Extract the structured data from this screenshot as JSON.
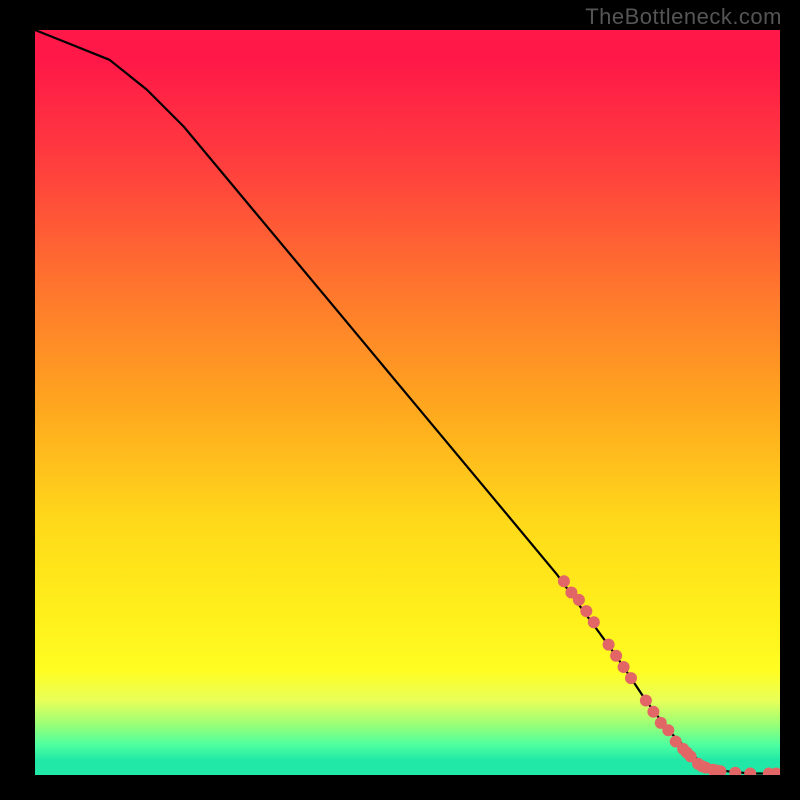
{
  "watermark": "TheBottleneck.com",
  "chart_data": {
    "type": "line",
    "title": "",
    "xlabel": "",
    "ylabel": "",
    "xlim": [
      0,
      100
    ],
    "ylim": [
      0,
      100
    ],
    "legend": false,
    "grid": false,
    "series": [
      {
        "name": "curve",
        "x": [
          0,
          5,
          10,
          15,
          20,
          30,
          40,
          50,
          60,
          70,
          78,
          82,
          85,
          88,
          90,
          93,
          96,
          100
        ],
        "y": [
          100,
          98,
          96,
          92,
          87,
          75,
          63,
          51,
          39,
          27,
          16,
          10,
          6,
          3,
          1,
          0.5,
          0.2,
          0.2
        ]
      }
    ],
    "markers": {
      "name": "highlighted-points",
      "color": "#e36666",
      "points": [
        {
          "x": 71,
          "y": 26
        },
        {
          "x": 72,
          "y": 24.5
        },
        {
          "x": 73,
          "y": 23.5
        },
        {
          "x": 74,
          "y": 22
        },
        {
          "x": 75,
          "y": 20.5
        },
        {
          "x": 77,
          "y": 17.5
        },
        {
          "x": 78,
          "y": 16
        },
        {
          "x": 79,
          "y": 14.5
        },
        {
          "x": 80,
          "y": 13
        },
        {
          "x": 82,
          "y": 10
        },
        {
          "x": 83,
          "y": 8.5
        },
        {
          "x": 84,
          "y": 7
        },
        {
          "x": 85,
          "y": 6
        },
        {
          "x": 86,
          "y": 4.5
        },
        {
          "x": 87,
          "y": 3.5
        },
        {
          "x": 87.5,
          "y": 3
        },
        {
          "x": 88,
          "y": 2.5
        },
        {
          "x": 89,
          "y": 1.5
        },
        {
          "x": 89.5,
          "y": 1.2
        },
        {
          "x": 90,
          "y": 1
        },
        {
          "x": 91,
          "y": 0.7
        },
        {
          "x": 91.5,
          "y": 0.6
        },
        {
          "x": 92,
          "y": 0.5
        },
        {
          "x": 94,
          "y": 0.3
        },
        {
          "x": 96,
          "y": 0.2
        },
        {
          "x": 98.5,
          "y": 0.2
        },
        {
          "x": 99.5,
          "y": 0.2
        }
      ]
    },
    "background_gradient": {
      "stops": [
        {
          "pct": 0,
          "color": "#ff1848"
        },
        {
          "pct": 4,
          "color": "#ff1848"
        },
        {
          "pct": 18,
          "color": "#ff3e3e"
        },
        {
          "pct": 36,
          "color": "#ff7a2c"
        },
        {
          "pct": 50,
          "color": "#ffa51f"
        },
        {
          "pct": 66,
          "color": "#ffd91a"
        },
        {
          "pct": 78,
          "color": "#ffef1b"
        },
        {
          "pct": 86,
          "color": "#fffd22"
        },
        {
          "pct": 90,
          "color": "#e8ff5a"
        },
        {
          "pct": 93,
          "color": "#9fff74"
        },
        {
          "pct": 96,
          "color": "#4dffa0"
        },
        {
          "pct": 98,
          "color": "#21e8a6"
        },
        {
          "pct": 100,
          "color": "#21e8a6"
        }
      ]
    }
  }
}
